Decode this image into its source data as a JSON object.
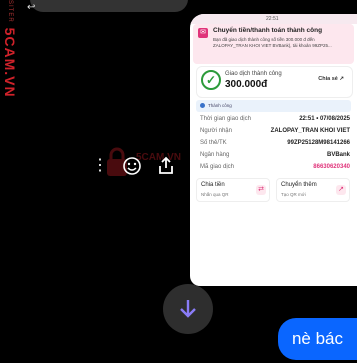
{
  "watermark": {
    "site": "5CAM.VN",
    "small": "SITER"
  },
  "notification": {
    "title": "Chuyển tiền/thanh toán thành công",
    "body": "Bạn đã giao dịch thành công số tiền 300.000 đ đến ZALOPAY_TRAN KHOI VIET BVBank), tài khoản 99ZP25..."
  },
  "status_bar": {
    "left": "",
    "mid": "22:51",
    "right": ""
  },
  "success": {
    "label": "Giao dịch thành công",
    "amount": "300.000đ",
    "share_label": "Chia sẻ"
  },
  "info_box": {
    "text": "Thành công"
  },
  "details": [
    {
      "label": "Thời gian giao dịch",
      "value": "22:51 • 07/08/2025",
      "pink": false
    },
    {
      "label": "Người nhận",
      "value": "ZALOPAY_TRAN KHOI VIET",
      "pink": false
    },
    {
      "label": "Số thẻ/TK",
      "value": "99ZP25128M98141266",
      "pink": false
    },
    {
      "label": "Ngân hàng",
      "value": "BVBank",
      "pink": false
    },
    {
      "label": "Mã giao dịch",
      "value": "86630620340",
      "pink": true
    }
  ],
  "buttons": [
    {
      "title": "Chia tiền",
      "sub": "Nhắn qua QR"
    },
    {
      "title": "Chuyển thêm",
      "sub": "Tạo QR mới"
    }
  ],
  "image_watermark": {
    "text": "5CAM.VN"
  },
  "message": {
    "text": "nè bác"
  },
  "icons": {
    "more": "more-vertical-icon",
    "emoji": "emoji-smile-icon",
    "share": "share-icon",
    "scroll": "arrow-down-icon"
  }
}
